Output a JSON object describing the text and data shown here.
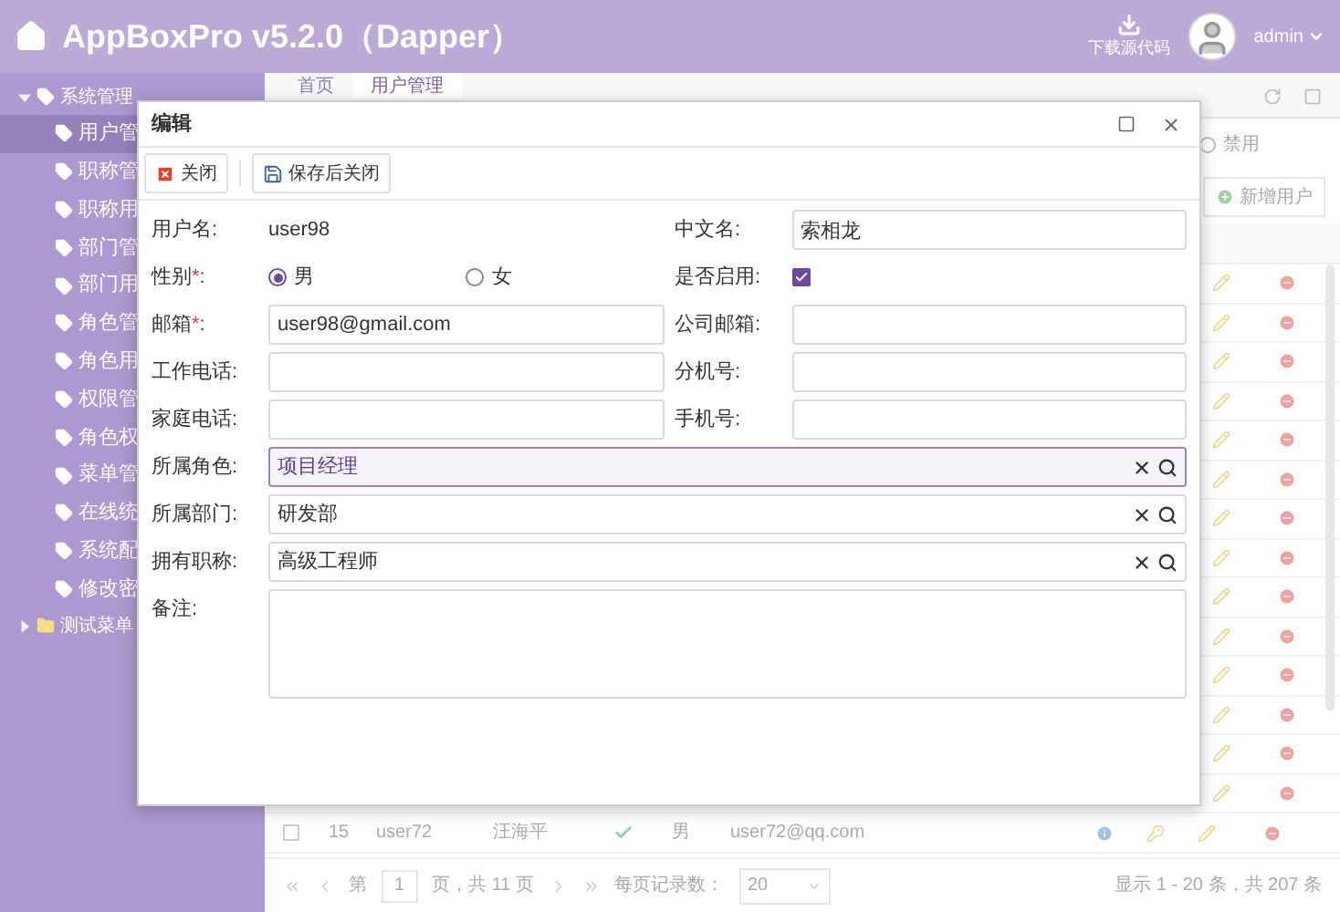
{
  "header": {
    "title": "AppBoxPro v5.2.0（Dapper）",
    "download_label": "下载源代码",
    "user": "admin"
  },
  "sidebar": {
    "items": [
      {
        "label": "系统管理",
        "expanded": true,
        "children": [
          {
            "label": "用户管",
            "selected": true
          },
          {
            "label": "职称管",
            "selected": false
          },
          {
            "label": "职称用",
            "selected": false
          },
          {
            "label": "部门管",
            "selected": false
          },
          {
            "label": "部门用",
            "selected": false
          },
          {
            "label": "角色管",
            "selected": false
          },
          {
            "label": "角色用",
            "selected": false
          },
          {
            "label": "权限管",
            "selected": false
          },
          {
            "label": "角色权",
            "selected": false
          },
          {
            "label": "菜单管",
            "selected": false
          },
          {
            "label": "在线统",
            "selected": false
          },
          {
            "label": "系统配",
            "selected": false
          },
          {
            "label": "修改密",
            "selected": false
          }
        ]
      },
      {
        "label": "测试菜单",
        "expanded": false
      }
    ]
  },
  "tabs": [
    {
      "label": "首页",
      "selected": false
    },
    {
      "label": "用户管理",
      "selected": true
    }
  ],
  "filter": {
    "radio_label": "禁用",
    "selected": false
  },
  "add_button": "新增用户",
  "table": {
    "last_row": {
      "cells": [
        "15",
        "user72",
        "汪海平",
        "男",
        "user72@qq.com"
      ],
      "enabled": true,
      "checked": false
    }
  },
  "pager": {
    "page_prefix": "第",
    "page": "1",
    "page_suffix": "页，共 11 页",
    "page_size_label": "每页记录数：",
    "page_size": "20",
    "summary": "显示 1 - 20 条，共 207 条"
  },
  "dialog": {
    "title": "编辑",
    "buttons": [
      {
        "label": "关闭",
        "kind": "close"
      },
      {
        "label": "保存后关闭",
        "kind": "save"
      }
    ],
    "rows": [
      {
        "fields": [
          {
            "label": "用户名:",
            "kind": "display",
            "value": "user98"
          },
          {
            "label": "中文名:",
            "kind": "text",
            "value": "索相龙"
          }
        ]
      },
      {
        "fields": [
          {
            "label": "性别",
            "required_mark": "*",
            "label_suffix": ":",
            "kind": "radio",
            "options": [
              {
                "label": "男",
                "selected": true
              },
              {
                "label": "女",
                "selected": false
              }
            ]
          },
          {
            "label": "是否启用:",
            "kind": "checkbox",
            "checked": true
          }
        ]
      },
      {
        "fields": [
          {
            "label": "邮箱",
            "required_mark": "*",
            "label_suffix": ":",
            "kind": "text",
            "value": "user98@gmail.com"
          },
          {
            "label": "公司邮箱:",
            "kind": "text"
          }
        ]
      },
      {
        "fields": [
          {
            "label": "工作电话:",
            "kind": "text"
          },
          {
            "label": "分机号:",
            "kind": "text"
          }
        ]
      },
      {
        "fields": [
          {
            "label": "家庭电话:",
            "kind": "text"
          },
          {
            "label": "手机号:",
            "kind": "text"
          }
        ]
      },
      {
        "fields": [
          {
            "label": "所属角色:",
            "kind": "trigger",
            "value": "项目经理",
            "focused": true
          }
        ]
      },
      {
        "fields": [
          {
            "label": "所属部门:",
            "kind": "trigger",
            "value": "研发部",
            "focused": false
          }
        ]
      },
      {
        "fields": [
          {
            "label": "拥有职称:",
            "kind": "trigger",
            "value": "高级工程师",
            "focused": false
          }
        ]
      },
      {
        "fields": [
          {
            "label": "备注:",
            "kind": "textarea"
          }
        ]
      }
    ]
  }
}
